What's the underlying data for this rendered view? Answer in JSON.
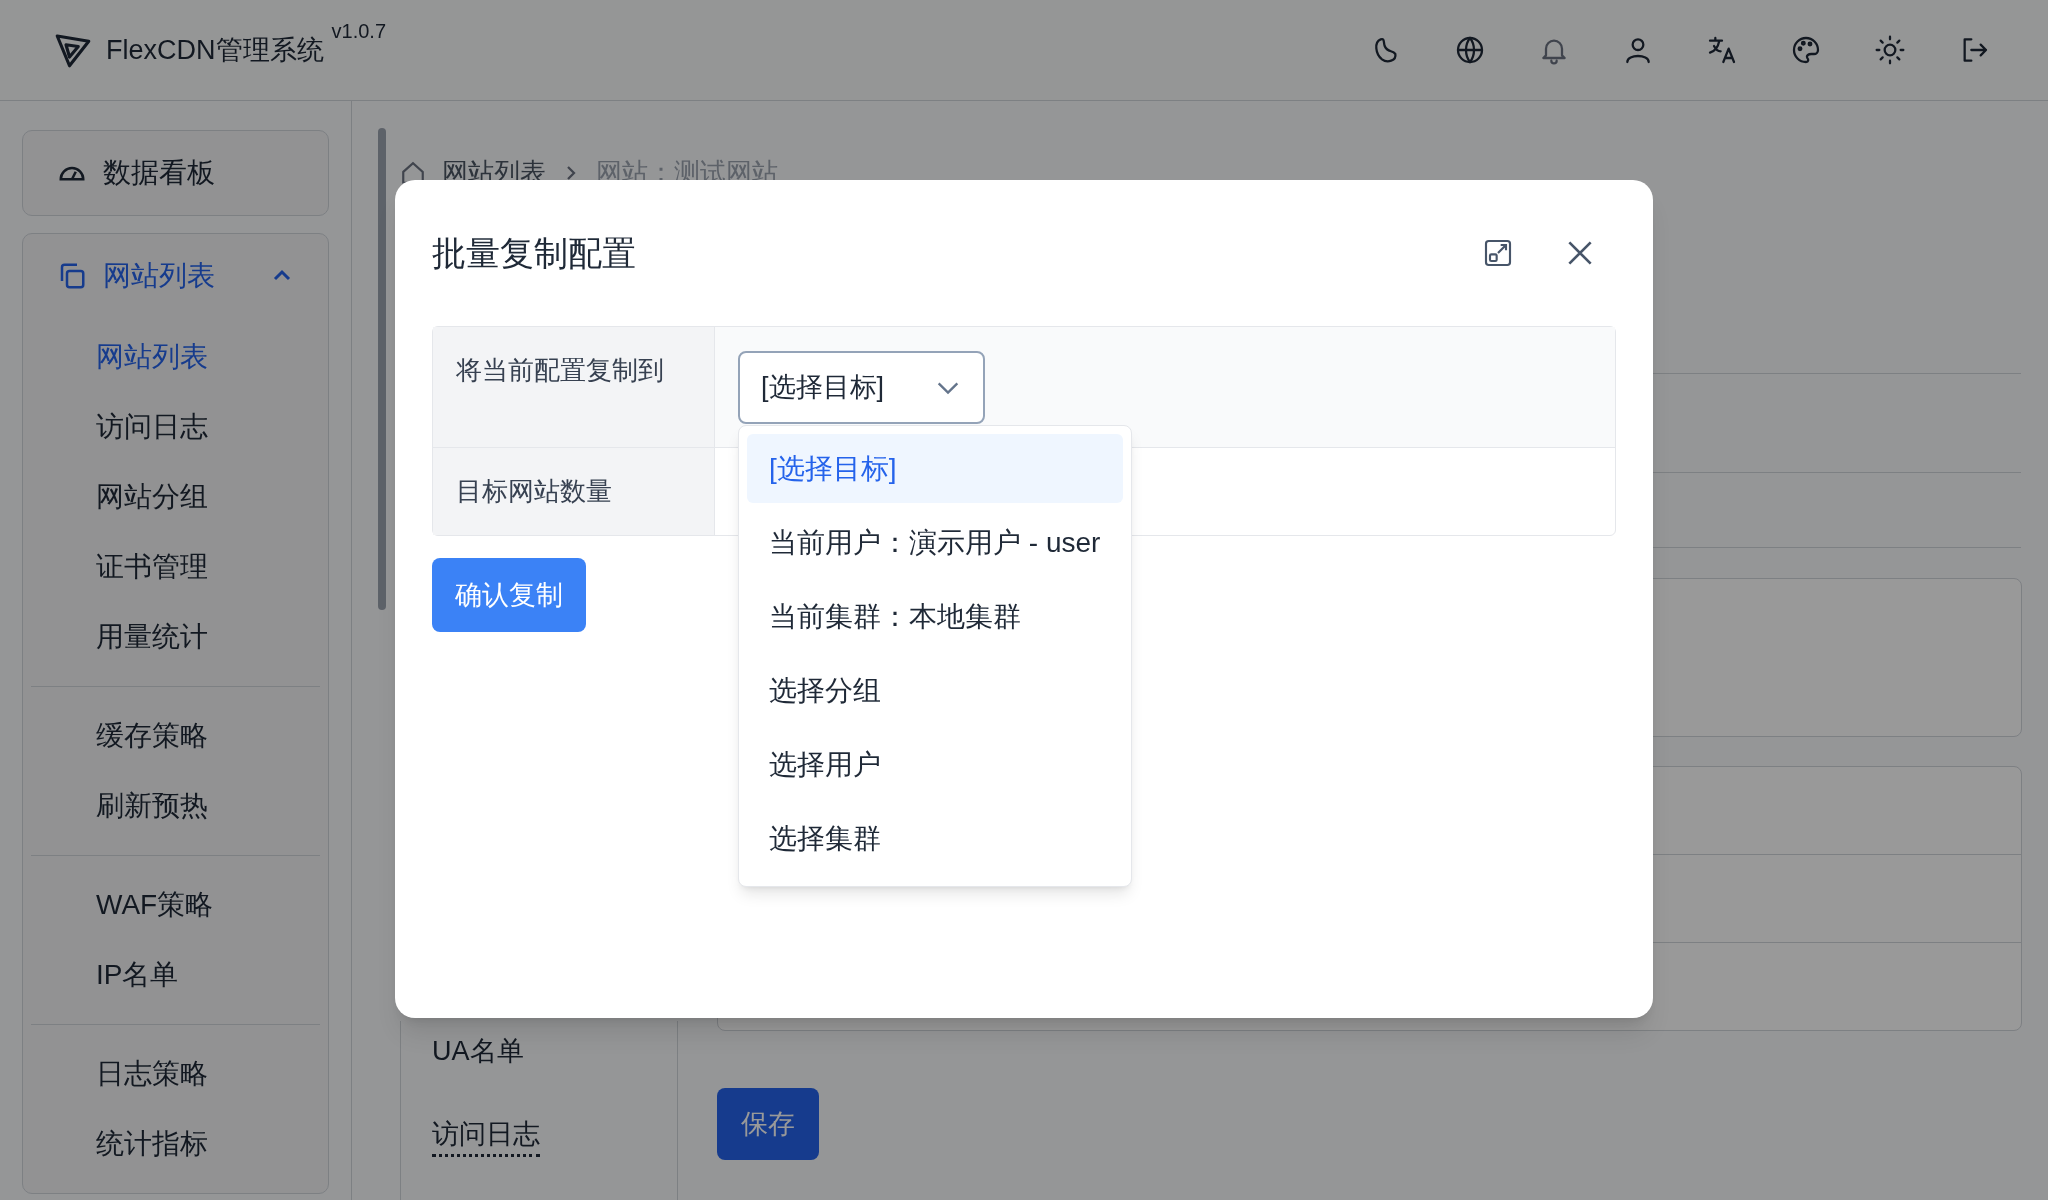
{
  "header": {
    "brand": "FlexCDN管理系统",
    "version": "v1.0.7"
  },
  "sidebar": {
    "items": [
      {
        "label": "数据看板",
        "kind": "link"
      },
      {
        "label": "网站列表",
        "kind": "group",
        "expanded": true,
        "sections": [
          [
            {
              "label": "网站列表",
              "selected": true
            },
            {
              "label": "访问日志",
              "selected": false
            },
            {
              "label": "网站分组",
              "selected": false
            },
            {
              "label": "证书管理",
              "selected": false
            },
            {
              "label": "用量统计",
              "selected": false
            }
          ],
          [
            {
              "label": "缓存策略",
              "selected": false
            },
            {
              "label": "刷新预热",
              "selected": false
            }
          ],
          [
            {
              "label": "WAF策略",
              "selected": false
            },
            {
              "label": "IP名单",
              "selected": false
            }
          ],
          [
            {
              "label": "日志策略",
              "selected": false
            },
            {
              "label": "统计指标",
              "selected": false
            }
          ]
        ]
      }
    ]
  },
  "breadcrumb": [
    "网站列表",
    "网站：测试网站"
  ],
  "settings_menu": [
    {
      "label": "UA名单",
      "kind": "plain"
    },
    {
      "label": "访问日志",
      "kind": "dotted"
    }
  ],
  "save_button": "保存",
  "dialog": {
    "title": "批量复制配置",
    "rows": [
      {
        "label": "将当前配置复制到",
        "kind": "select"
      },
      {
        "label": "目标网站数量",
        "kind": "text"
      }
    ],
    "select": {
      "value": "[选择目标]",
      "expanded": true,
      "options": [
        {
          "label": "[选择目标]",
          "selected": true
        },
        {
          "label": "当前用户：演示用户 - user",
          "selected": false
        },
        {
          "label": "当前集群：本地集群",
          "selected": false
        },
        {
          "label": "选择分组",
          "selected": false
        },
        {
          "label": "选择用户",
          "selected": false
        },
        {
          "label": "选择集群",
          "selected": false
        }
      ]
    },
    "confirm_button": "确认复制"
  }
}
